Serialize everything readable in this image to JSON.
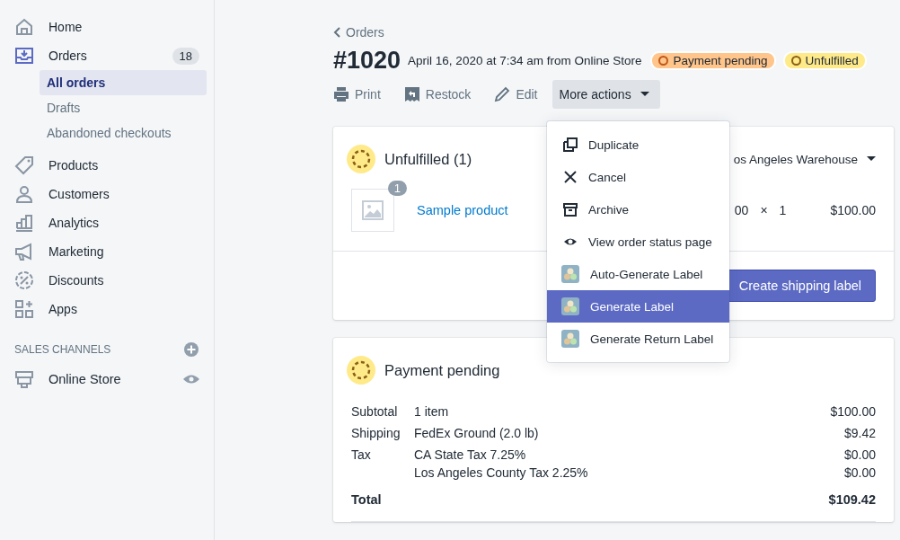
{
  "sidebar": {
    "items": [
      {
        "label": "Home",
        "selected": false
      },
      {
        "label": "Orders",
        "badge": "18",
        "selected": false,
        "children": [
          {
            "label": "All orders",
            "selected": true
          },
          {
            "label": "Drafts",
            "selected": false
          },
          {
            "label": "Abandoned checkouts",
            "selected": false
          }
        ]
      },
      {
        "label": "Products",
        "selected": false
      },
      {
        "label": "Customers",
        "selected": false
      },
      {
        "label": "Analytics",
        "selected": false
      },
      {
        "label": "Marketing",
        "selected": false
      },
      {
        "label": "Discounts",
        "selected": false
      },
      {
        "label": "Apps",
        "selected": false
      }
    ],
    "section_title": "SALES CHANNELS",
    "channels": [
      {
        "label": "Online Store"
      }
    ]
  },
  "breadcrumb": "Orders",
  "order": {
    "number": "#1020",
    "meta": "April 16, 2020 at 7:34 am from Online Store",
    "badges": [
      {
        "label": "Payment pending",
        "color": "#ffc58b"
      },
      {
        "label": "Unfulfilled",
        "color": "#ffea8a"
      }
    ]
  },
  "actions": [
    {
      "label": "Print"
    },
    {
      "label": "Restock"
    },
    {
      "label": "Edit"
    }
  ],
  "more_actions": {
    "label": "More actions",
    "expanded": true,
    "items": [
      {
        "label": "Duplicate",
        "kind": "duplicate",
        "selected": false
      },
      {
        "label": "Cancel",
        "kind": "cancel",
        "selected": false
      },
      {
        "label": "Archive",
        "kind": "archive",
        "selected": false
      },
      {
        "label": "View order status page",
        "kind": "view",
        "selected": false
      },
      {
        "label": "Auto-Generate Label",
        "kind": "app",
        "selected": false
      },
      {
        "label": "Generate Label",
        "kind": "app",
        "selected": true
      },
      {
        "label": "Generate Return Label",
        "kind": "app",
        "selected": false
      }
    ]
  },
  "fulfillment": {
    "title": "Unfulfilled (1)",
    "location": "os Angeles Warehouse",
    "items": [
      {
        "name": "Sample product",
        "quantity_badge": "1",
        "price": "00",
        "times": "×",
        "quantity": "1",
        "total": "$100.00"
      }
    ],
    "button": "Create shipping label"
  },
  "payment": {
    "title": "Payment pending",
    "rows": [
      {
        "label": "Subtotal",
        "lines": [
          {
            "text": "1 item",
            "amount": "$100.00"
          }
        ]
      },
      {
        "label": "Shipping",
        "lines": [
          {
            "text": "FedEx Ground (2.0 lb)",
            "amount": "$9.42"
          }
        ]
      },
      {
        "label": "Tax",
        "lines": [
          {
            "text": "CA State Tax 7.25%",
            "amount": "$0.00"
          },
          {
            "text": "Los Angeles County Tax 2.25%",
            "amount": "$0.00"
          }
        ]
      }
    ],
    "total": {
      "label": "Total",
      "amount": "$109.42"
    }
  }
}
